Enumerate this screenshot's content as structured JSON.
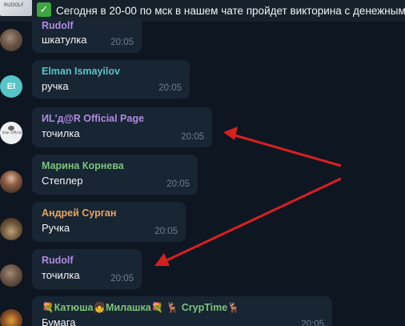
{
  "pinned": {
    "thumbnail_label": "RUDOLF",
    "check_icon": "white-check-mark-icon",
    "text": "Сегодня в 20-00 по мск в нашем чате пройдет викторина с денежными"
  },
  "messages": [
    {
      "sender": "Rudolf",
      "text": "шкатулка",
      "time": "20:05",
      "sender_color": "#b18ae0",
      "avatar": "cow-photo"
    },
    {
      "sender": "Elman Ismayilov",
      "text": "ручка",
      "time": "20:05",
      "sender_color": "#57c4c8",
      "avatar": "initials",
      "initials": "EI"
    },
    {
      "sender": "ИL'д@R Official Page",
      "text": "точилка",
      "time": "20:05",
      "sender_color": "#b18ae0",
      "avatar": "logo"
    },
    {
      "sender": "Марина Корнева",
      "text": "Степлер",
      "time": "20:05",
      "sender_color": "#7cc47a",
      "avatar": "woman-photo"
    },
    {
      "sender": "Андрей Сурган",
      "text": "Ручка",
      "time": "20:05",
      "sender_color": "#e9a45f",
      "avatar": "group-photo"
    },
    {
      "sender": "Rudolf",
      "text": "точилка",
      "time": "20:05",
      "sender_color": "#b18ae0",
      "avatar": "cow-photo"
    },
    {
      "sender": "💐Катюша👧Милашка💐 🦌 CrypTime🦌",
      "text": "Бумага",
      "time": "20:05",
      "sender_color": "#7cc47a",
      "avatar": "flowers-photo"
    }
  ],
  "annotation": {
    "arrow_color": "#d62020"
  }
}
